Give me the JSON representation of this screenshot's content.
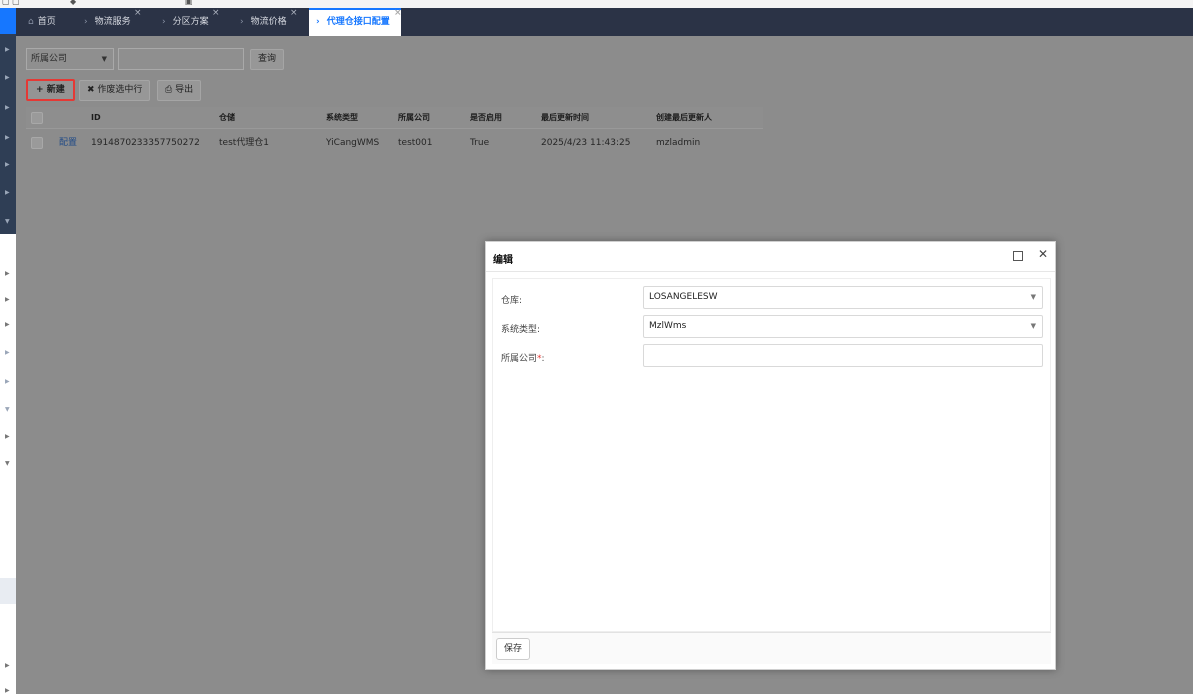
{
  "tabs": {
    "home": "首页",
    "logistics_service": "物流服务",
    "zone_plan": "分区方案",
    "logistics_price": "物流价格",
    "active": "代理仓接口配置"
  },
  "filter": {
    "company_select": "所属公司",
    "search_button": "查询"
  },
  "toolbar": {
    "new_button": "新建",
    "void_button": "作废选中行",
    "export_button": "导出"
  },
  "grid": {
    "columns": [
      "ID",
      "仓储",
      "系统类型",
      "所属公司",
      "是否启用",
      "最后更新时间",
      "创建最后更新人"
    ],
    "rows": [
      {
        "action": "配置",
        "id": "1914870233357750272",
        "warehouse": "test代理仓1",
        "system_type": "YiCangWMS",
        "company": "test001",
        "enabled": "True",
        "updated_at": "2025/4/23 11:43:25",
        "updated_by": "mzladmin"
      }
    ]
  },
  "dialog": {
    "title": "编辑",
    "fields": {
      "warehouse_label": "仓库:",
      "warehouse_value": "LOSANGELESW",
      "system_label": "系统类型:",
      "system_value": "MzlWms",
      "company_label": "所属公司",
      "company_required": "*",
      "company_colon": ":",
      "company_value": ""
    },
    "save_button": "保存"
  },
  "colors": {
    "accent": "#1677ff",
    "tabbar": "#2b3346",
    "sidebar": "#2f3e55",
    "highlight": "#e53935"
  }
}
